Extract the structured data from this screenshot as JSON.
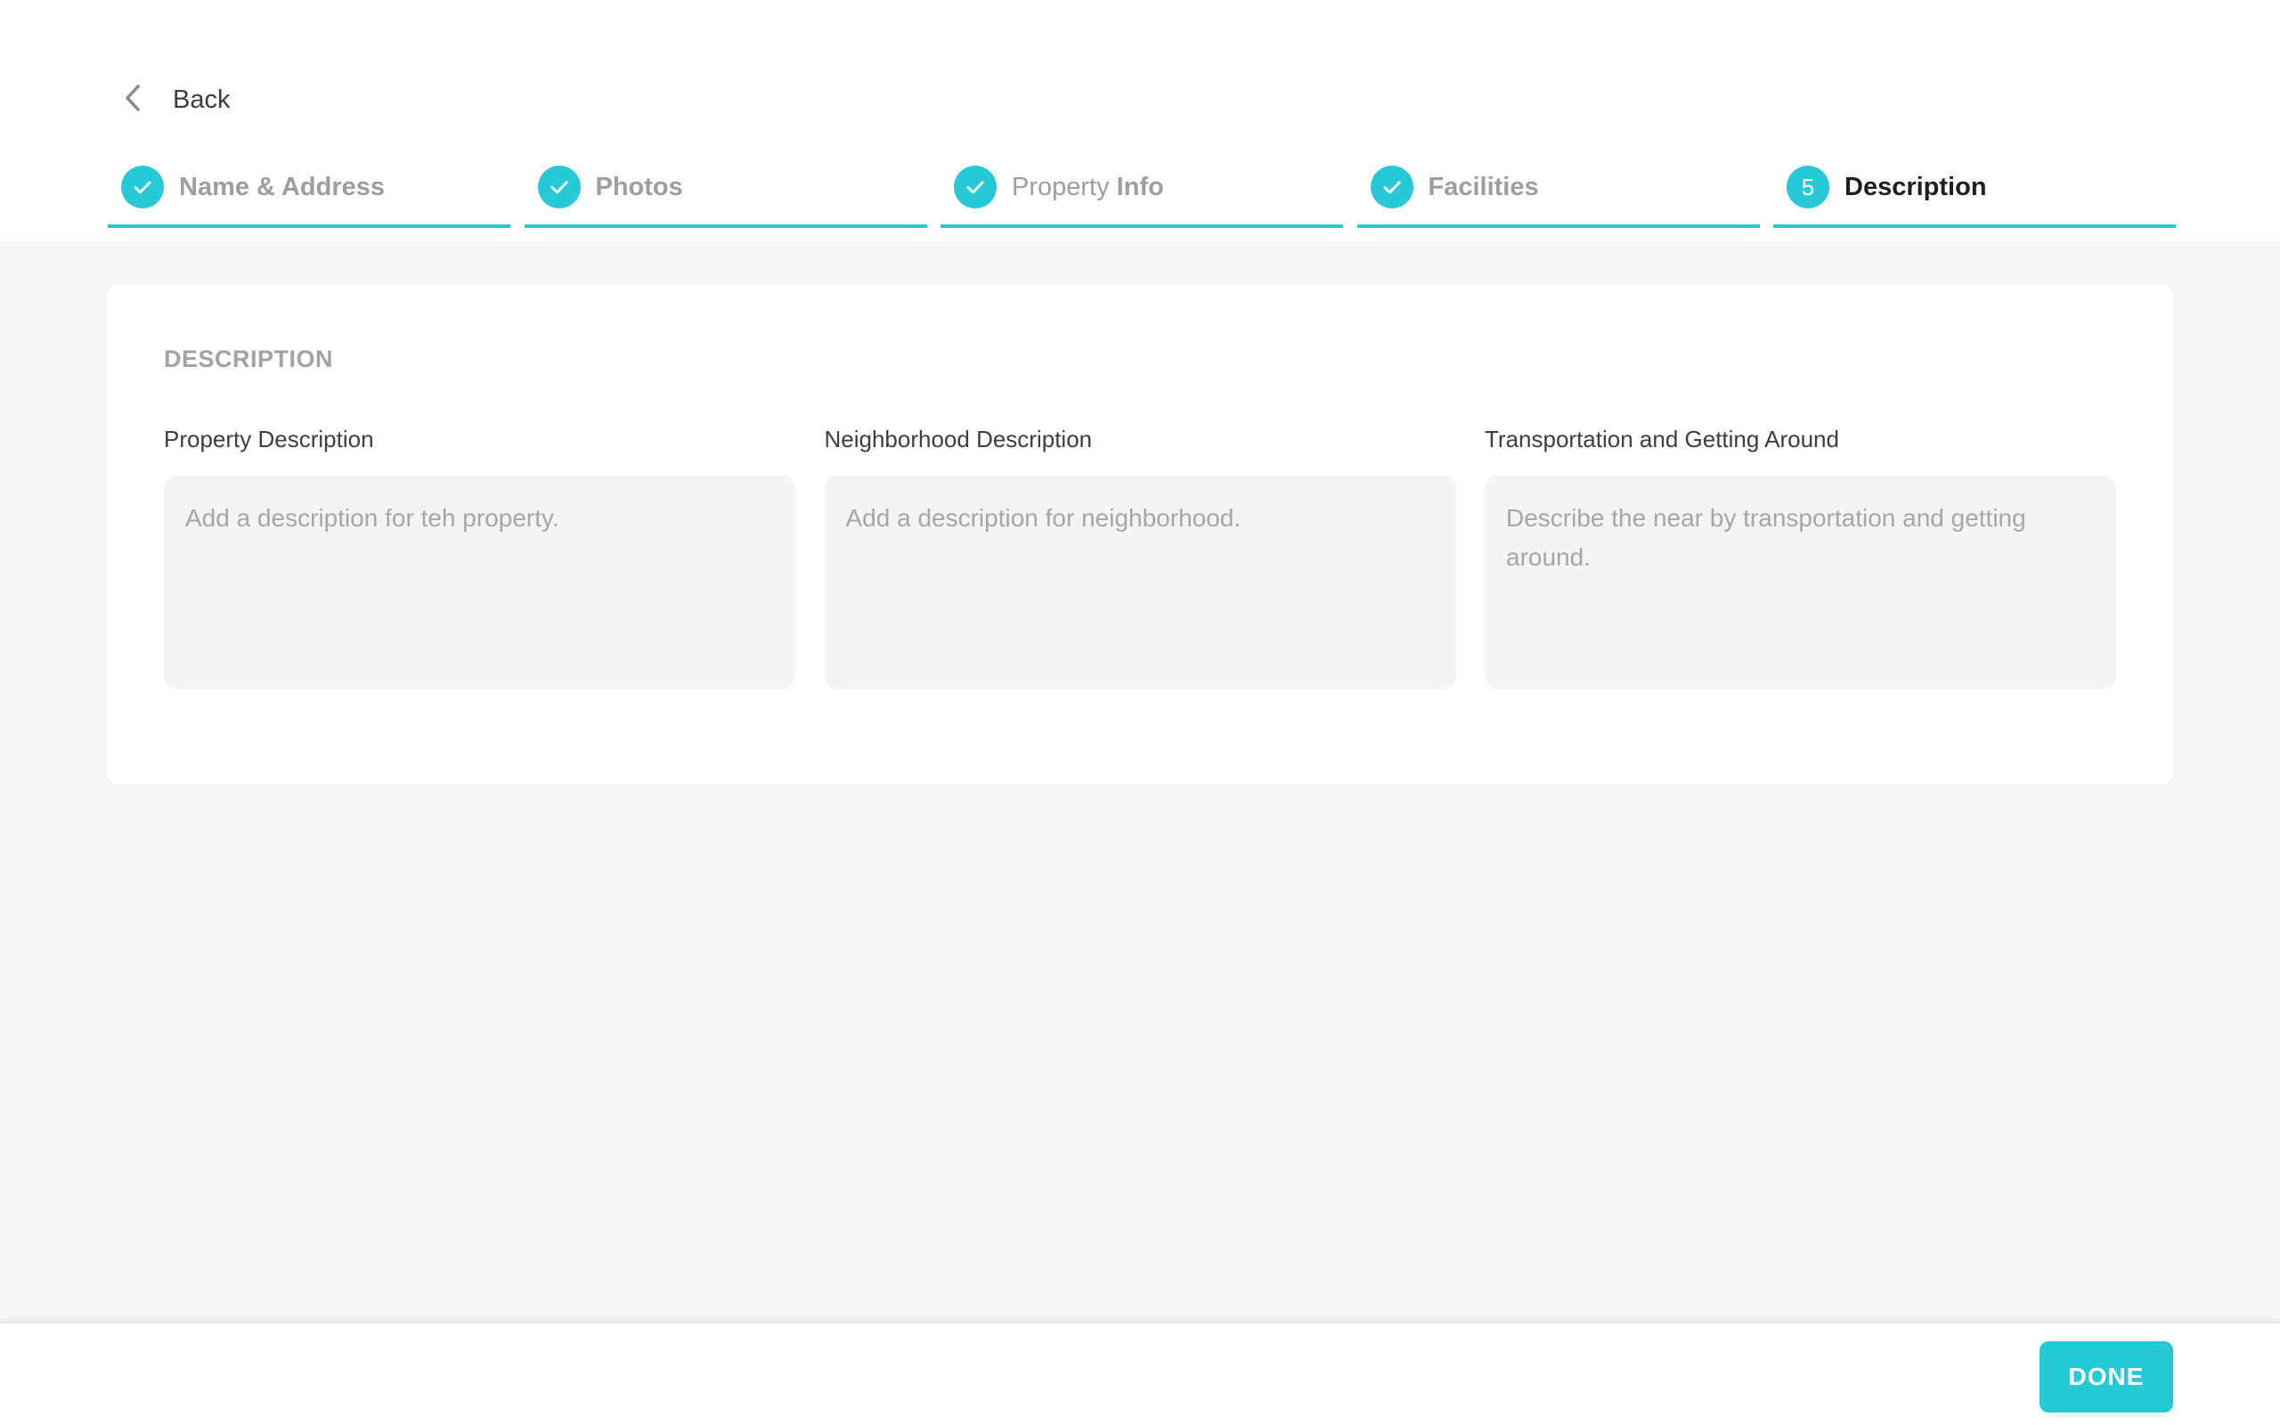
{
  "colors": {
    "accent": "#26c9d6",
    "page_background": "#f5f5f5",
    "muted_text": "#9e9e9e"
  },
  "nav": {
    "back_label": "Back",
    "back_icon": "chevron-left-icon"
  },
  "steps": [
    {
      "label": "Name & Address",
      "status": "complete",
      "icon": "check-icon"
    },
    {
      "label": "Photos",
      "status": "complete",
      "icon": "check-icon"
    },
    {
      "label_light": "Property",
      "label_bold": "Info",
      "status": "complete",
      "icon": "check-icon"
    },
    {
      "label": "Facilities",
      "status": "complete",
      "icon": "check-icon"
    },
    {
      "number": "5",
      "label": "Description",
      "status": "active"
    }
  ],
  "section": {
    "title": "DESCRIPTION",
    "fields": [
      {
        "label": "Property Description",
        "value": "",
        "placeholder": "Add a description for teh property."
      },
      {
        "label": "Neighborhood Description",
        "value": "",
        "placeholder": "Add a description for neighborhood."
      },
      {
        "label": "Transportation and Getting Around",
        "value": "",
        "placeholder": "Describe the near by transportation and getting around."
      }
    ]
  },
  "footer": {
    "done_label": "DONE"
  }
}
